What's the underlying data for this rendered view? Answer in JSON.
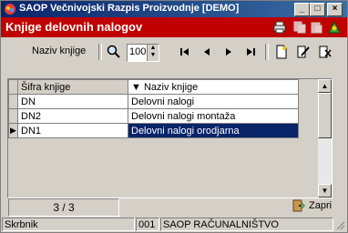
{
  "window": {
    "title": "SAOP  Večnivojski Razpis Proizvodnje [DEMO]",
    "controls": {
      "minimize": "_",
      "maximize": "□",
      "close": "×"
    }
  },
  "header": {
    "title": "Knjige delovnih nalogov"
  },
  "toolbar": {
    "sort_label": "Naziv knjige",
    "page_size": "100"
  },
  "grid": {
    "columns": [
      "Šifra knjige",
      "Naziv knjige"
    ],
    "sort_indicator": "▼",
    "rows": [
      {
        "code": "DN",
        "name": "Delovni nalogi"
      },
      {
        "code": "DN2",
        "name": "Delovni nalogi montaža"
      },
      {
        "code": "DN1",
        "name": "Delovni nalogi orodjarna"
      }
    ]
  },
  "footer": {
    "record_position": "3 / 3",
    "close_label": "Zapri"
  },
  "statusbar": {
    "user": "Skrbnik",
    "company_code": "001",
    "company_name": "SAOP RAČUNALNIŠTVO"
  },
  "colors": {
    "titlebar": "#0a246a",
    "header": "#c00000",
    "sorted_column": "#00e0e0",
    "selection": "#0a246a"
  }
}
